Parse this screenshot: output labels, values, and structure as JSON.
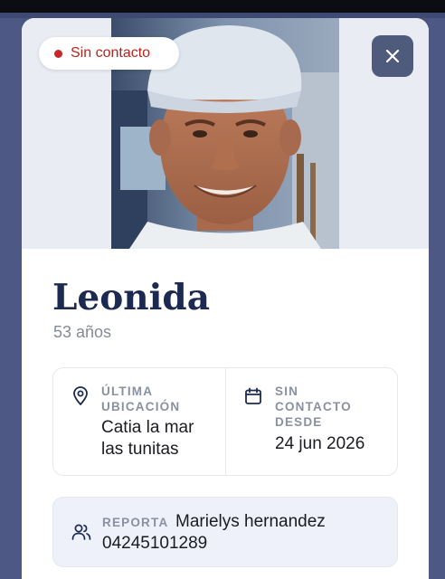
{
  "person": {
    "status": "Sin contacto",
    "name": "Leonida",
    "age": "53 años"
  },
  "last_location": {
    "label_line1": "ÚLTIMA",
    "label_line2": "UBICACIÓN",
    "value_line1": "Catia la mar",
    "value_line2": "las tunitas"
  },
  "missing_since": {
    "label_line1": "SIN",
    "label_line2": "CONTACTO",
    "label_line3": "DESDE",
    "value": "24 jun 2026"
  },
  "report": {
    "label": "REPORTA",
    "reporter": "Marielys hernandez",
    "phone": "04245101289"
  },
  "icons": {
    "close": "close-icon",
    "location": "map-pin-icon",
    "calendar": "calendar-icon",
    "reporter": "users-icon"
  },
  "colors": {
    "status_red": "#c62828",
    "title_navy": "#1c2a52",
    "close_button": "#4f5b7c",
    "report_bg": "#eef1f9"
  }
}
